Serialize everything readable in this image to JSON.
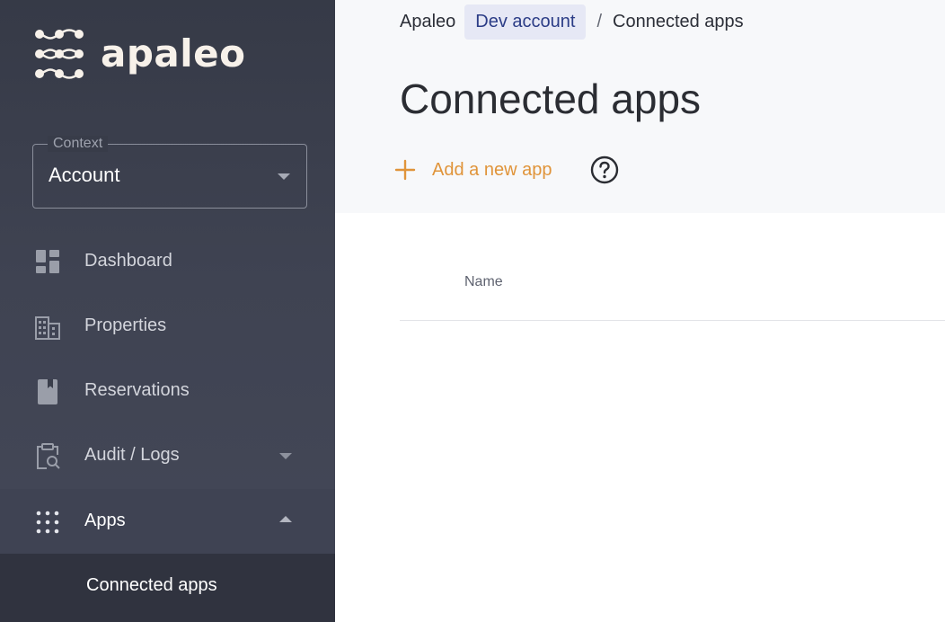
{
  "brand": {
    "name": "apaleo"
  },
  "sidebar": {
    "context": {
      "label": "Context",
      "value": "Account"
    },
    "items": [
      {
        "label": "Dashboard",
        "icon": "dashboard-icon"
      },
      {
        "label": "Properties",
        "icon": "building-icon"
      },
      {
        "label": "Reservations",
        "icon": "book-icon"
      },
      {
        "label": "Audit / Logs",
        "icon": "clipboard-search-icon",
        "expanded": false
      },
      {
        "label": "Apps",
        "icon": "apps-grid-icon",
        "expanded": true
      }
    ],
    "subitems": [
      {
        "label": "Connected apps",
        "active": true
      }
    ]
  },
  "breadcrumb": {
    "root": "Apaleo",
    "account": "Dev account",
    "separator": "/",
    "current": "Connected apps"
  },
  "page": {
    "title": "Connected apps",
    "add_button": "Add a new app",
    "help_icon": "help-circle-icon"
  },
  "table": {
    "columns": [
      "Name"
    ],
    "rows": []
  },
  "colors": {
    "sidebar_bg": "#3f4352",
    "accent_orange": "#e0943a",
    "breadcrumb_active_bg": "#e6e8f5",
    "breadcrumb_active_text": "#2b3c86",
    "header_bg": "#f7f8fa"
  }
}
